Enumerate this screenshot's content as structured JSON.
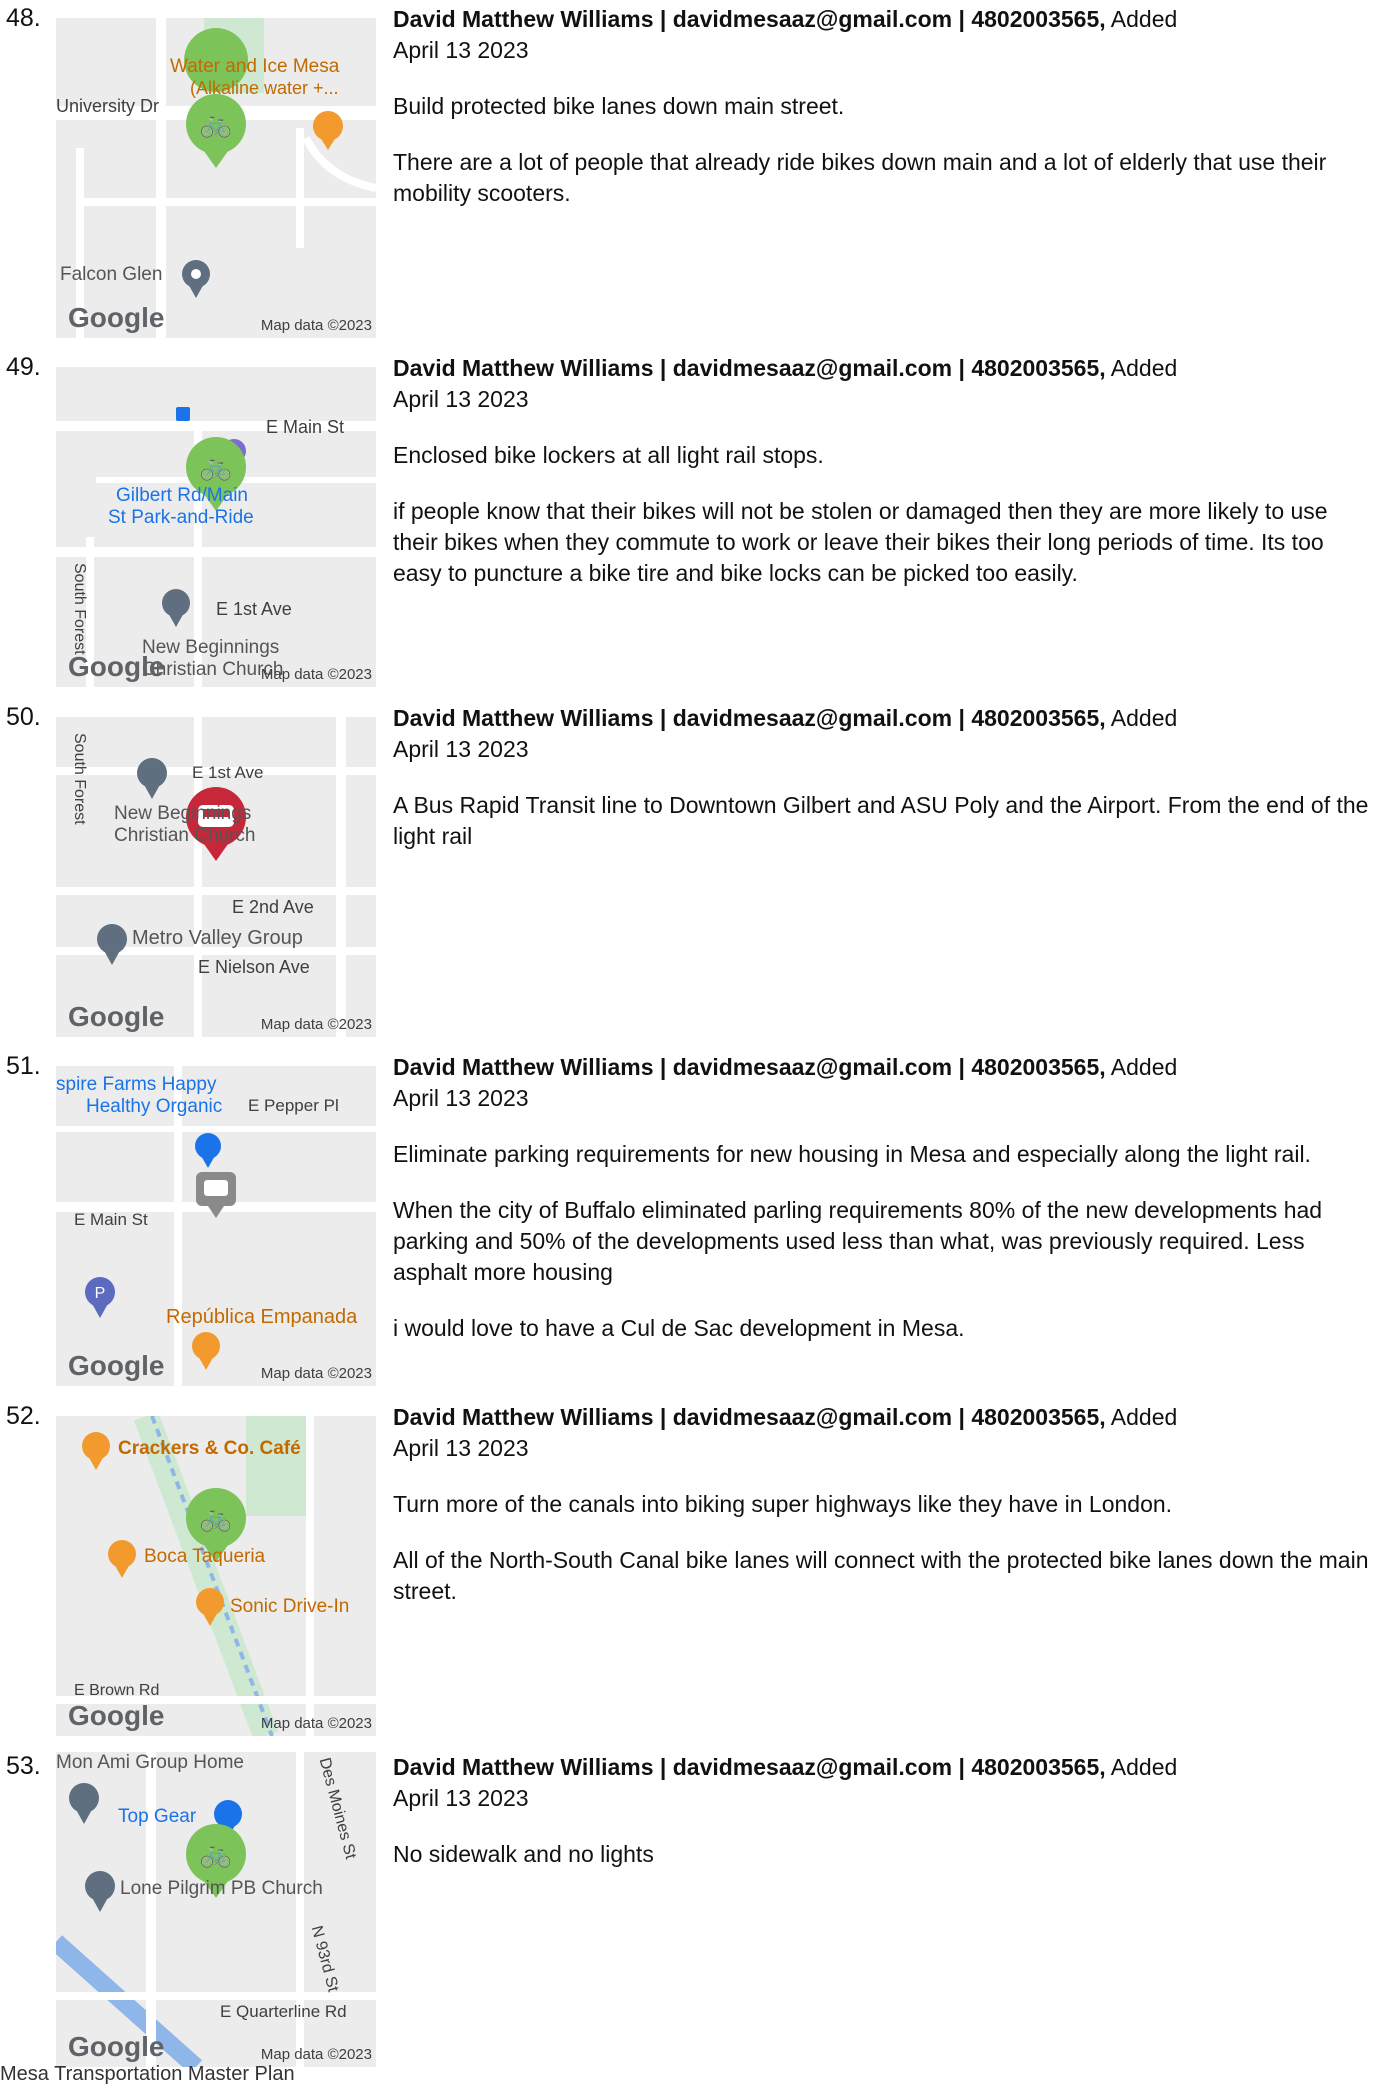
{
  "entries": [
    {
      "number": "48.",
      "author": "David Matthew Williams",
      "email": "davidmesaaz@gmail.com",
      "phone": "4802003565",
      "added": "Added",
      "date": "April 13 2023",
      "paragraphs": [
        "Build protected bike lanes down main street.",
        "There are a lot of people that already ride bikes down main and a lot of elderly that use their mobility scooters."
      ],
      "map": {
        "labels": [
          "Water and Ice Mesa",
          "(Alkaline water +...",
          "University Dr",
          "Falcon Glen"
        ],
        "google": "Google",
        "credit": "Map data ©2023",
        "marker": "bike-marker-icon"
      }
    },
    {
      "number": "49.",
      "author": "David Matthew Williams",
      "email": "davidmesaaz@gmail.com",
      "phone": "4802003565",
      "added": "Added",
      "date": "April 13 2023",
      "paragraphs": [
        "Enclosed bike lockers at all light rail stops.",
        "if people know that their bikes will not be stolen or damaged then they are more likely to use their bikes when they commute to work or leave their bikes their long periods of time. Its too easy to puncture a bike tire and bike locks can be picked too easily."
      ],
      "map": {
        "labels": [
          "E Main St",
          "Gilbert Rd/Main",
          "St Park-and-Ride",
          "South Forest",
          "E 1st Ave",
          "New Beginnings",
          "Christian Church"
        ],
        "google": "Google",
        "credit": "Map data ©2023",
        "marker": "bike-marker-icon"
      }
    },
    {
      "number": "50.",
      "author": "David Matthew Williams",
      "email": "davidmesaaz@gmail.com",
      "phone": "4802003565",
      "added": "Added",
      "date": "April 13 2023",
      "paragraphs": [
        "A Bus Rapid Transit line to Downtown Gilbert and ASU Poly and the Airport. From the end of the light rail"
      ],
      "map": {
        "labels": [
          "South Forest",
          "E 1st Ave",
          "New Beginnings",
          "Christian Church",
          "E 2nd Ave",
          "Metro Valley Group",
          "E Nielson Ave"
        ],
        "google": "Google",
        "credit": "Map data ©2023",
        "marker": "bus-marker-icon"
      }
    },
    {
      "number": "51.",
      "author": "David Matthew Williams",
      "email": "davidmesaaz@gmail.com",
      "phone": "4802003565",
      "added": "Added",
      "date": "April 13 2023",
      "paragraphs": [
        "Eliminate parking requirements for new housing in Mesa and especially along the light rail.",
        "When the city of Buffalo eliminated parling requirements 80% of the new developments had parking and 50% of the developments used less than what, was previously required. Less asphalt more housing",
        "i would love to have a Cul de Sac development in Mesa."
      ],
      "map": {
        "labels": [
          "spire Farms Happy",
          "Healthy Organic",
          "E Pepper Pl",
          "E Main St",
          "República Empanada"
        ],
        "google": "Google",
        "credit": "Map data ©2023",
        "marker": "comment-marker-icon"
      }
    },
    {
      "number": "52.",
      "author": "David Matthew Williams",
      "email": "davidmesaaz@gmail.com",
      "phone": "4802003565",
      "added": "Added",
      "date": "April 13 2023",
      "paragraphs": [
        "Turn more of the canals into biking super highways like they have in London.",
        "All of the North-South Canal bike lanes will connect with the protected bike lanes down the main street."
      ],
      "map": {
        "labels": [
          "Crackers & Co. Café",
          "Boca Taqueria",
          "Sonic Drive-In",
          "E Brown Rd"
        ],
        "google": "Google",
        "credit": "Map data ©2023",
        "marker": "bike-marker-icon"
      }
    },
    {
      "number": "53.",
      "author": "David Matthew Williams",
      "email": "davidmesaaz@gmail.com",
      "phone": "4802003565",
      "added": "Added",
      "date": "April 13 2023",
      "paragraphs": [
        "No sidewalk and no lights"
      ],
      "map": {
        "labels": [
          "Mon Ami Group Home",
          "Top Gear",
          "Lone Pilgrim PB Church",
          "Des Moines St",
          "N 93rd St",
          "E Quarterline Rd"
        ],
        "google": "Google",
        "credit": "Map data ©2023",
        "marker": "bike-marker-icon"
      }
    }
  ],
  "footer": "Mesa Transportation Master Plan",
  "colors": {
    "map_bg": "#ececec",
    "road": "#ffffff",
    "park": "#cfe8d2",
    "green_marker": "#7cc35a",
    "red_marker": "#c6283a",
    "poi_orange": "#f29a2e",
    "water": "#8fb6e8"
  }
}
